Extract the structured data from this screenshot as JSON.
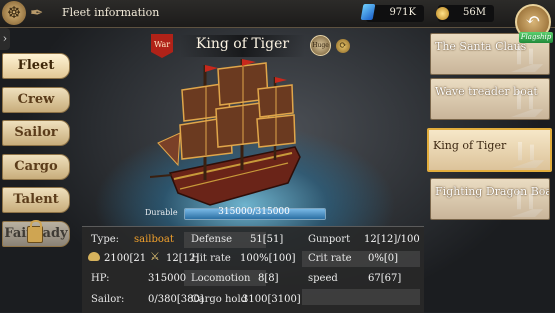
{
  "topbar": {
    "title": "Fleet information",
    "gems": "971K",
    "coins": "56M"
  },
  "menu": [
    {
      "label": "Fleet",
      "active": true
    },
    {
      "label": "Crew",
      "active": false
    },
    {
      "label": "Sailor",
      "active": false
    },
    {
      "label": "Cargo",
      "active": false
    },
    {
      "label": "Talent",
      "active": false
    },
    {
      "label": "Fair lady",
      "active": false,
      "locked": true
    }
  ],
  "ship": {
    "name": "King of Tiger",
    "war_badge": "War",
    "size_badge": "Huge",
    "durable_label": "Durable",
    "durable_value": "315000/315000",
    "durable_fraction": 1.0
  },
  "ship_list": [
    {
      "name": "The Santa Claus",
      "flag": "Flagship",
      "selected": false
    },
    {
      "name": "Wave treader boat",
      "selected": false
    },
    {
      "name": "King of Tiger",
      "selected": true
    },
    {
      "name": "Fighting Dragon Boat",
      "selected": false
    }
  ],
  "stats": {
    "type_label": "Type:",
    "type_value": "sailboat",
    "crew_value": "2100[21",
    "attack_value": "12[12]",
    "hp_label": "HP:",
    "hp_value": "315000",
    "sailor_label": "Sailor:",
    "sailor_value": "0/380[380]",
    "defense_label": "Defense",
    "defense_value": "51[51]",
    "hit_label": "Hit rate",
    "hit_value": "100%[100]",
    "loco_label": "Locomotion",
    "loco_value": "8[8]",
    "cargo_label": "Cargo hold",
    "cargo_value": "3100[3100]",
    "gunport_label": "Gunport",
    "gunport_value": "12[12]/100",
    "crit_label": "Crit rate",
    "crit_value": "0%[0]",
    "speed_label": "speed",
    "speed_value": "67[67]"
  },
  "colors": {
    "accent_gold": "#e2ad3c",
    "type_value": "#f0a02c",
    "war_red": "#b02218"
  }
}
